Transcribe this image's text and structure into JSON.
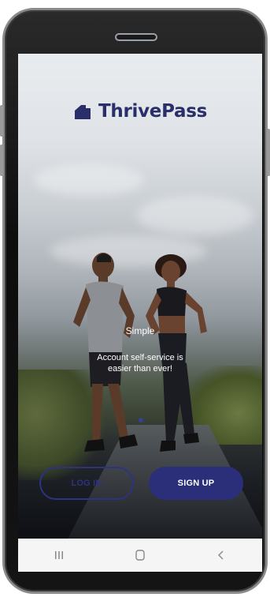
{
  "app": {
    "brand_name": "ThrivePass",
    "brand_color": "#2a2f6b"
  },
  "onboarding": {
    "slide_title": "Simple",
    "slide_text": "Account self-service is easier than ever!",
    "page_count": 1,
    "active_page": 1
  },
  "actions": {
    "login_label": "LOG IN",
    "signup_label": "SIGN UP",
    "primary_color": "#2b2f7a"
  },
  "system_nav": {
    "items": [
      {
        "name": "recent-apps-icon"
      },
      {
        "name": "home-icon"
      },
      {
        "name": "back-icon"
      }
    ]
  }
}
